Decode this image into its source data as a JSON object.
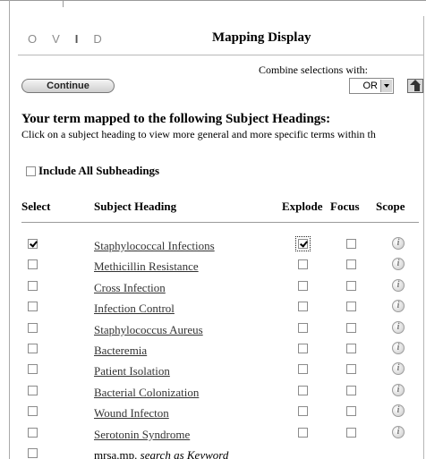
{
  "header": {
    "logo_letters": [
      "O",
      "V",
      "I",
      "D"
    ],
    "title": "Mapping Display"
  },
  "toolbar": {
    "continue_label": "Continue",
    "combine_label": "Combine selections with:",
    "combine_value": "OR"
  },
  "mapped": {
    "heading": "Your term mapped to the following Subject Headings:",
    "description": "Click on a subject heading to view more general and more specific terms within th"
  },
  "include_all": {
    "label": "Include All Subheadings",
    "checked": false
  },
  "table": {
    "headers": {
      "select": "Select",
      "subject_heading": "Subject Heading",
      "explode": "Explode",
      "focus": "Focus",
      "scope": "Scope"
    },
    "rows": [
      {
        "heading": "Staphylococcal Infections",
        "select": true,
        "explode": true,
        "focus": false
      },
      {
        "heading": "Methicillin Resistance",
        "select": false,
        "explode": false,
        "focus": false
      },
      {
        "heading": "Cross Infection",
        "select": false,
        "explode": false,
        "focus": false
      },
      {
        "heading": "Infection Control",
        "select": false,
        "explode": false,
        "focus": false
      },
      {
        "heading": "Staphylococcus Aureus",
        "select": false,
        "explode": false,
        "focus": false
      },
      {
        "heading": "Bacteremia",
        "select": false,
        "explode": false,
        "focus": false
      },
      {
        "heading": "Patient Isolation",
        "select": false,
        "explode": false,
        "focus": false
      },
      {
        "heading": "Bacterial Colonization",
        "select": false,
        "explode": false,
        "focus": false
      },
      {
        "heading": "Wound Infecton",
        "select": false,
        "explode": false,
        "focus": false
      },
      {
        "heading": "Serotonin Syndrome",
        "select": false,
        "explode": false,
        "focus": false
      }
    ],
    "scope_icon": "info-icon",
    "keyword_row": {
      "term": "mrsa.mp.",
      "action": "search as Keyword",
      "select": false
    }
  }
}
